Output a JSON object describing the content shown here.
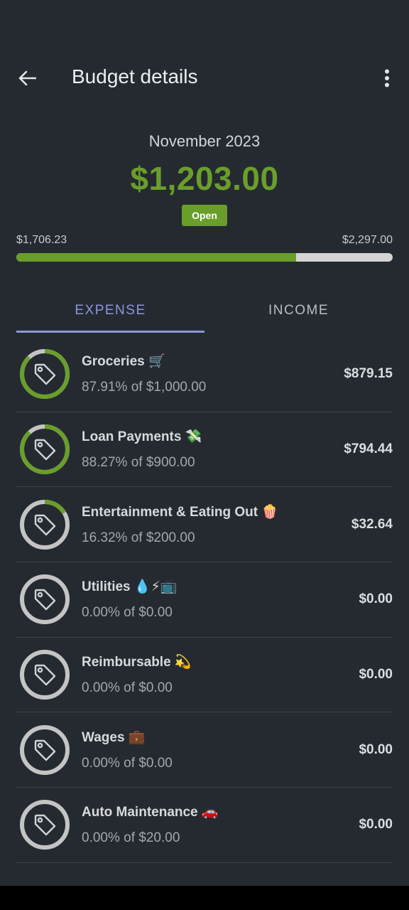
{
  "app_bar": {
    "title": "Budget details",
    "back_icon": "arrow-left-icon",
    "more_icon": "more-vert-icon"
  },
  "summary": {
    "month": "November 2023",
    "amount": "$1,203.00",
    "status": "Open",
    "range_min": "$1,706.23",
    "range_max": "$2,297.00",
    "progress_fraction": 0.743
  },
  "tabs": [
    {
      "label": "EXPENSE",
      "active": true
    },
    {
      "label": "INCOME",
      "active": false
    }
  ],
  "colors": {
    "accent_green": "#6a9e2b",
    "tab_accent": "#8a97d8",
    "ring_track": "#c4c4c4"
  },
  "categories": [
    {
      "name": "Groceries 🛒",
      "sub": "87.91% of $1,000.00",
      "amount": "$879.15",
      "fraction": 0.8791,
      "icon": "tag-icon"
    },
    {
      "name": "Loan Payments 💸",
      "sub": "88.27% of $900.00",
      "amount": "$794.44",
      "fraction": 0.8827,
      "icon": "tag-icon"
    },
    {
      "name": "Entertainment & Eating Out 🍿",
      "sub": "16.32% of $200.00",
      "amount": "$32.64",
      "fraction": 0.1632,
      "icon": "tag-icon"
    },
    {
      "name": "Utilities 💧⚡📺",
      "sub": "0.00% of $0.00",
      "amount": "$0.00",
      "fraction": 0,
      "icon": "tag-icon"
    },
    {
      "name": "Reimbursable 💫",
      "sub": "0.00% of $0.00",
      "amount": "$0.00",
      "fraction": 0,
      "icon": "tag-icon"
    },
    {
      "name": "Wages 💼",
      "sub": "0.00% of $0.00",
      "amount": "$0.00",
      "fraction": 0,
      "icon": "tag-icon"
    },
    {
      "name": "Auto Maintenance 🚗",
      "sub": "0.00% of $20.00",
      "amount": "$0.00",
      "fraction": 0,
      "icon": "tag-icon"
    }
  ]
}
